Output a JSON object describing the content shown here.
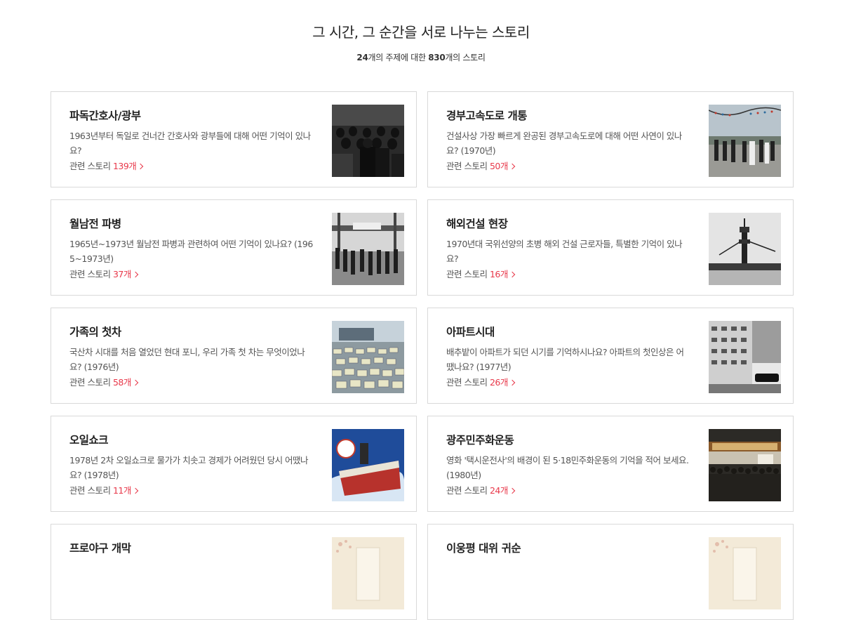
{
  "header": {
    "title": "그 시간, 그 순간을 서로 나누는 스토리",
    "subtitle_topics": "24",
    "subtitle_mid1": "개의 주제에 대한 ",
    "subtitle_stories": "830",
    "subtitle_end": "개의 스토리"
  },
  "related_label": "관련 스토리 ",
  "cards": [
    {
      "title": "파독간호사/광부",
      "desc": "1963년부터 독일로 건너간 간호사와 광부들에 대해 어떤 기억이 있나요?",
      "count": "139개",
      "thumb_icon": "photo-miners-icon"
    },
    {
      "title": "경부고속도로 개통",
      "desc": "건설사상 가장 빠르게 완공된 경부고속도로에 대해 어떤 사연이 있나요? (1970년)",
      "count": "50개",
      "thumb_icon": "photo-highway-icon"
    },
    {
      "title": "월남전 파병",
      "desc": "1965년~1973년 월남전 파병과 관련하여 어떤 기억이 있나요? (1965~1973년)",
      "count": "37개",
      "thumb_icon": "photo-soldiers-icon"
    },
    {
      "title": "해외건설 현장",
      "desc": "1970년대 국위선양의 초병 해외 건설 근로자들, 특별한 기억이 있나요?",
      "count": "16개",
      "thumb_icon": "photo-construction-icon"
    },
    {
      "title": "가족의 첫차",
      "desc": "국산차 시대를 처음 열었던 현대 포니, 우리 가족 첫 차는 무엇이었나요? (1976년)",
      "count": "58개",
      "thumb_icon": "photo-cars-icon"
    },
    {
      "title": "아파트시대",
      "desc": "배추밭이 아파트가 되던 시기를 기억하시나요? 아파트의 첫인상은 어땠나요? (1977년)",
      "count": "26개",
      "thumb_icon": "photo-apartment-icon"
    },
    {
      "title": "오일쇼크",
      "desc": "1978년 2차 오일쇼크로 물가가 치솟고 경제가 어려웠던 당시 어땠나요? (1978년)",
      "count": "11개",
      "thumb_icon": "poster-oilshock-icon"
    },
    {
      "title": "광주민주화운동",
      "desc": "영화 '택시운전사'의 배경이 된 5·18민주화운동의 기억을 적어 보세요. (1980년)",
      "count": "24개",
      "thumb_icon": "photo-crowd-icon"
    },
    {
      "title": "프로야구 개막",
      "desc": "",
      "count": "",
      "thumb_icon": "paper-ticket-icon"
    },
    {
      "title": "이웅평 대위 귀순",
      "desc": "",
      "count": "",
      "thumb_icon": "paper-ticket-icon"
    }
  ]
}
